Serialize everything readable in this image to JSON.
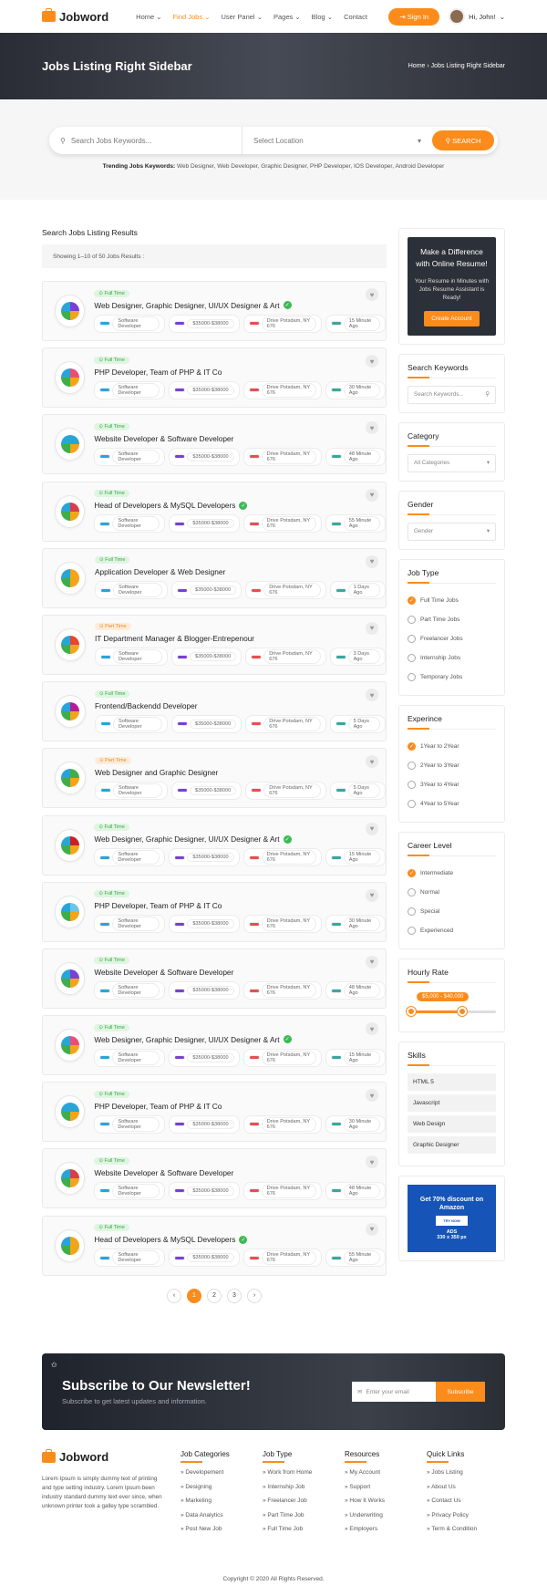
{
  "header": {
    "brand": "Jobword",
    "nav": [
      {
        "label": "Home",
        "caret": "⌄",
        "active": false
      },
      {
        "label": "Find Jobs",
        "caret": "⌄",
        "active": true
      },
      {
        "label": "User Panel",
        "caret": "⌄",
        "active": false
      },
      {
        "label": "Pages",
        "caret": "⌄",
        "active": false
      },
      {
        "label": "Blog",
        "caret": "⌄",
        "active": false
      },
      {
        "label": "Contact",
        "caret": "",
        "active": false
      }
    ],
    "signin": "Sign In",
    "user": "Hi, John!"
  },
  "banner": {
    "title": "Jobs Listing Right Sidebar",
    "crumb_home": "Home",
    "crumb_current": "Jobs Listing Right Sidebar"
  },
  "search": {
    "keyword_placeholder": "Search Jobs Keywords...",
    "location_placeholder": "Select Location",
    "button": "SEARCH",
    "trending_label": "Trending Jobs Keywords:",
    "trending_text": "Web Designer, Web Developer, Graphic Designer, PHP Developer, IOS Developer, Android Developer"
  },
  "results": {
    "heading": "Search Jobs Listing Results",
    "showing": "Showing 1–10 of 50 Jobs Results :",
    "jobs": [
      {
        "type": "Full Time",
        "title": "Web Designer, Graphic Designer, UI/UX Designer & Art",
        "verified": true,
        "category": "Software Developer",
        "salary": "$35000-$38000",
        "location": "Drive Potsdam, NY 676",
        "time": "15 Minute Ago",
        "logo_color": "#7a3fd6"
      },
      {
        "type": "Full Time",
        "title": "PHP Developer, Team of PHP & IT Co",
        "verified": false,
        "category": "Software Developer",
        "salary": "$35000-$38000",
        "location": "Drive Potsdam, NY 676",
        "time": "30 Minute Ago",
        "logo_color": "#e94e77"
      },
      {
        "type": "Full Time",
        "title": "Website Developer & Software Developer",
        "verified": false,
        "category": "Software Developer",
        "salary": "$35000-$38000",
        "location": "Drive Potsdam, NY 676",
        "time": "48 Minute Ago",
        "logo_color": "#27a5d9"
      },
      {
        "type": "Full Time",
        "title": "Head of Developers & MySQL Developers",
        "verified": true,
        "category": "Software Developer",
        "salary": "$35000-$38000",
        "location": "Drive Potsdam, NY 676",
        "time": "55 Minute Ago",
        "logo_color": "#d93c4a"
      },
      {
        "type": "Full Time",
        "title": "Application Developer & Web Designer",
        "verified": false,
        "category": "Software Developer",
        "salary": "$35000-$38000",
        "location": "Drive Potsdam, NY 676",
        "time": "1 Days Ago",
        "logo_color": "#f2a51a"
      },
      {
        "type": "Part Time",
        "title": "IT Department Manager & Blogger-Entrepenour",
        "verified": false,
        "category": "Software Developer",
        "salary": "$35000-$38000",
        "location": "Drive Potsdam, NY 676",
        "time": "3 Days Ago",
        "logo_color": "#e6452e"
      },
      {
        "type": "Full Time",
        "title": "Frontend/Backendd Developer",
        "verified": false,
        "category": "Software Developer",
        "salary": "$35000-$38000",
        "location": "Drive Potsdam, NY 676",
        "time": "5 Days Ago",
        "logo_color": "#b31f8e"
      },
      {
        "type": "Part Time",
        "title": "Web Designer and Graphic Designer",
        "verified": false,
        "category": "Software Developer",
        "salary": "$35000-$38000",
        "location": "Drive Potsdam, NY 676",
        "time": "5 Days Ago",
        "logo_color": "#3fae4a"
      },
      {
        "type": "Full Time",
        "title": "Web Designer, Graphic Designer, UI/UX Designer & Art",
        "verified": true,
        "category": "Software Developer",
        "salary": "$35000-$38000",
        "location": "Drive Potsdam, NY 676",
        "time": "15 Minute Ago",
        "logo_color": "#c8202b"
      },
      {
        "type": "Full Time",
        "title": "PHP Developer, Team of PHP & IT Co",
        "verified": false,
        "category": "Software Developer",
        "salary": "$35000-$38000",
        "location": "Drive Potsdam, NY 676",
        "time": "30 Minute Ago",
        "logo_color": "#6cc5e6"
      },
      {
        "type": "Full Time",
        "title": "Website Developer & Software Developer",
        "verified": false,
        "category": "Software Developer",
        "salary": "$35000-$38000",
        "location": "Drive Potsdam, NY 676",
        "time": "48 Minute Ago",
        "logo_color": "#7a3fd6"
      },
      {
        "type": "Full Time",
        "title": "Web Designer, Graphic Designer, UI/UX Designer & Art",
        "verified": true,
        "category": "Software Developer",
        "salary": "$35000-$38000",
        "location": "Drive Potsdam, NY 676",
        "time": "15 Minute Ago",
        "logo_color": "#e94e77"
      },
      {
        "type": "Full Time",
        "title": "PHP Developer, Team of PHP & IT Co",
        "verified": false,
        "category": "Software Developer",
        "salary": "$35000-$38000",
        "location": "Drive Potsdam, NY 676",
        "time": "30 Minute Ago",
        "logo_color": "#27a5d9"
      },
      {
        "type": "Full Time",
        "title": "Website Developer & Software Developer",
        "verified": false,
        "category": "Software Developer",
        "salary": "$35000-$38000",
        "location": "Drive Potsdam, NY 676",
        "time": "48 Minute Ago",
        "logo_color": "#d93c4a"
      },
      {
        "type": "Full Time",
        "title": "Head of Developers & MySQL Developers",
        "verified": true,
        "category": "Software Developer",
        "salary": "$35000-$38000",
        "location": "Drive Potsdam, NY 676",
        "time": "55 Minute Ago",
        "logo_color": "#f2a51a"
      }
    ],
    "pages": [
      "‹",
      "1",
      "2",
      "3",
      "›"
    ],
    "current_page": "1"
  },
  "sidebar": {
    "promo": {
      "title": "Make a Difference with Online Resume!",
      "text": "Your Resume in Minutes with Jobs Resume Assistant is Ready!",
      "button": "Create Account"
    },
    "keywords": {
      "title": "Search Keywords",
      "placeholder": "Search Keywords..."
    },
    "category": {
      "title": "Category",
      "selected": "All Categories"
    },
    "gender": {
      "title": "Gender",
      "selected": "Gender"
    },
    "job_type": {
      "title": "Job Type",
      "options": [
        {
          "label": "Full Time Jobs",
          "checked": true
        },
        {
          "label": "Part Time Jobs",
          "checked": false
        },
        {
          "label": "Freelancer Jobs",
          "checked": false
        },
        {
          "label": "Internship Jobs",
          "checked": false
        },
        {
          "label": "Temporary Jobs",
          "checked": false
        }
      ]
    },
    "experience": {
      "title": "Experince",
      "options": [
        {
          "label": "1Year to 2Year",
          "checked": true
        },
        {
          "label": "2Year to 3Year",
          "checked": false
        },
        {
          "label": "3Year to 4Year",
          "checked": false
        },
        {
          "label": "4Year to 5Year",
          "checked": false
        }
      ]
    },
    "career": {
      "title": "Career Level",
      "options": [
        {
          "label": "Intermediate",
          "checked": true
        },
        {
          "label": "Normal",
          "checked": false
        },
        {
          "label": "Special",
          "checked": false
        },
        {
          "label": "Experienced",
          "checked": false
        }
      ]
    },
    "hourly": {
      "title": "Hourly Rate",
      "range_label": "$5,000 - $40,000",
      "min_fraction": 0.0,
      "max_fraction": 0.6
    },
    "skills": {
      "title": "Skills",
      "items": [
        "HTML 5",
        "Javascript",
        "Web Design",
        "Graphic Designer"
      ]
    },
    "ad": {
      "line1": "Get 70% discount on Amazon",
      "cta": "TRY NOW",
      "line2": "ADS",
      "line3": "330 x 350 px"
    }
  },
  "newsletter": {
    "title": "Subscribe to Our Newsletter!",
    "subtitle": "Subscribe to get latest updates and information.",
    "placeholder": "Enter your email",
    "button": "Subscribe"
  },
  "footer": {
    "brand": "Jobword",
    "about": "Lorem Ipsum is simply dummy text of printing and type setting industry. Lorem Ipsum been industry standard dummy text ever since, when unknown printer took a galley type scrambled.",
    "columns": [
      {
        "title": "Job Categories",
        "links": [
          "Developement",
          "Designing",
          "Marketing",
          "Data Analytics",
          "Post New Job"
        ]
      },
      {
        "title": "Job Type",
        "links": [
          "Work from Home",
          "Internship Job",
          "Freelancer Job",
          "Part Time Job",
          "Full Time Job"
        ]
      },
      {
        "title": "Resources",
        "links": [
          "My Account",
          "Support",
          "How It Works",
          "Underwriting",
          "Employers"
        ]
      },
      {
        "title": "Quick Links",
        "links": [
          "Jobs Listing",
          "About Us",
          "Contact Us",
          "Privacy Policy",
          "Term & Condition"
        ]
      }
    ],
    "copyright": "Copyright © 2020 All Rights Reserved."
  },
  "colors": {
    "accent": "#fb8c1c",
    "verified": "#3cba54"
  }
}
